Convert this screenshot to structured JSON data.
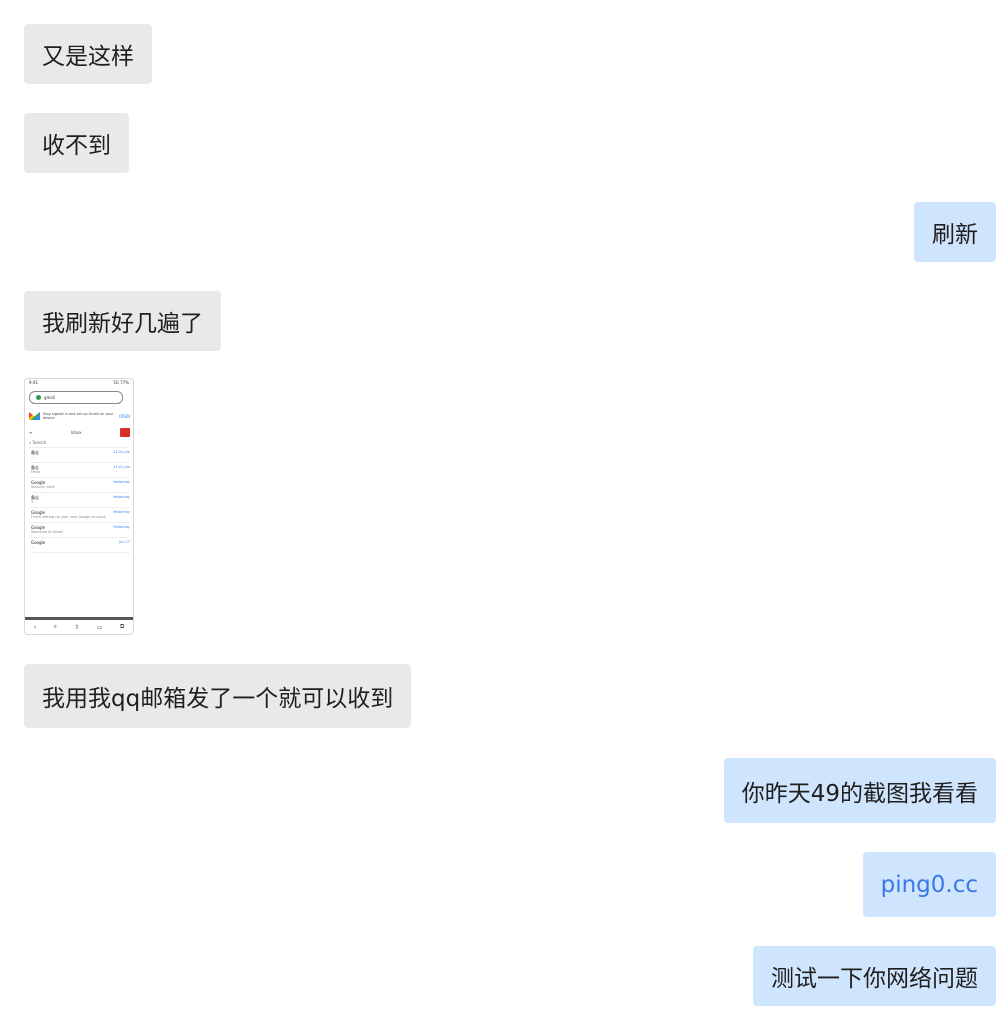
{
  "messages": [
    {
      "side": "in",
      "text": "又是这样"
    },
    {
      "side": "in",
      "text": "收不到"
    },
    {
      "side": "out",
      "text": "刷新"
    },
    {
      "side": "in",
      "text": "我刷新好几遍了"
    },
    {
      "side": "in",
      "type": "image",
      "text": ""
    },
    {
      "side": "in",
      "text": "我用我qq邮箱发了一个就可以收到"
    },
    {
      "side": "out",
      "text": "你昨天49的截图我看看"
    },
    {
      "side": "out",
      "text": "ping0.cc",
      "link": true
    },
    {
      "side": "out",
      "text": "测试一下你网络问题"
    }
  ],
  "thumbnail": {
    "status_left": "9:41",
    "status_right": "5G 77%",
    "url": "gmail",
    "banner_text": "Stay signed in and set up Gmail on your device",
    "banner_action": "OPEN",
    "inbox_label": "Inbox",
    "search_label": "Search",
    "rows": [
      {
        "sender": "备忘",
        "subject": "...",
        "time": "11:24 pm"
      },
      {
        "sender": "备忘",
        "subject": "Hello",
        "time": "11:22 pm"
      },
      {
        "sender": "Google",
        "subject": "Security alert",
        "time": "Yesterday"
      },
      {
        "sender": "备忘",
        "subject": "1",
        "time": "Yesterday"
      },
      {
        "sender": "Google",
        "subject": "Finish setting up your new Google Account",
        "time": "Yesterday"
      },
      {
        "sender": "Google",
        "subject": "Welcome to Gmail",
        "time": "Yesterday"
      },
      {
        "sender": "Google",
        "subject": "...",
        "time": "Jun 27"
      }
    ]
  },
  "colors": {
    "incoming_bubble": "#e9e9eb",
    "outgoing_bubble": "#cfe4fd",
    "link": "#3b78e7"
  }
}
